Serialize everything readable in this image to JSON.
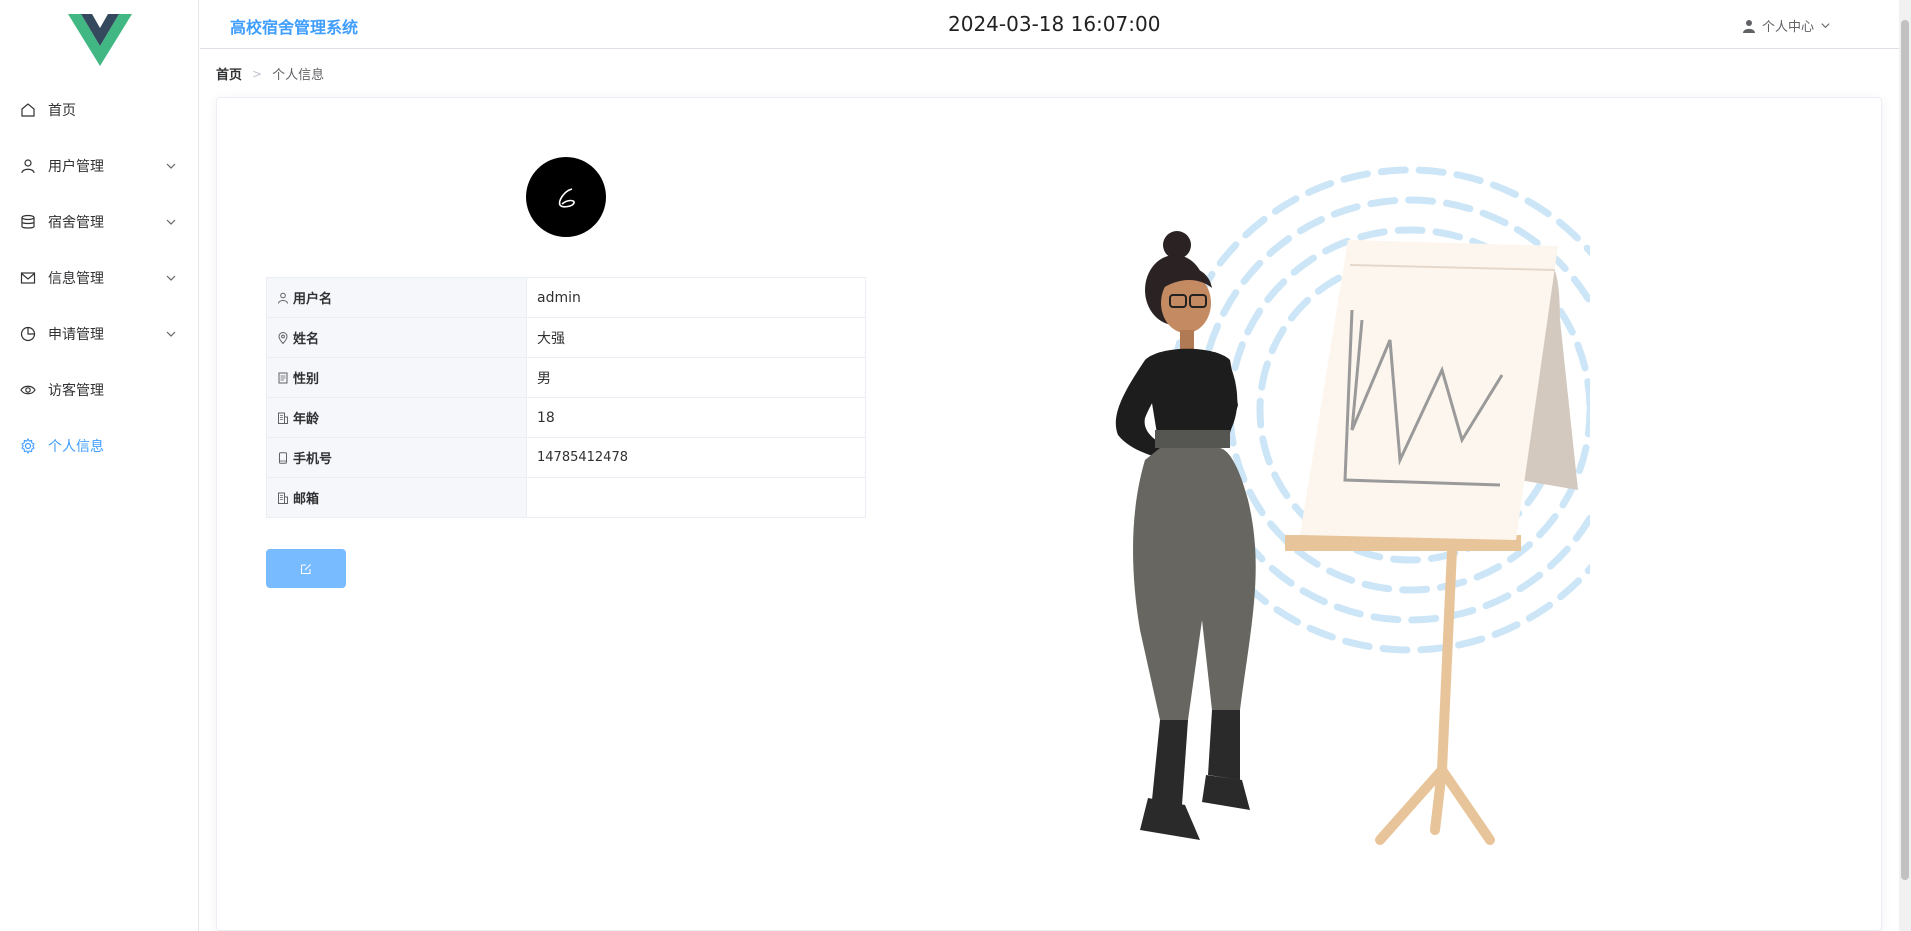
{
  "sidebar": {
    "logo_icon": "vue-logo-icon",
    "items": [
      {
        "label": "首页",
        "icon": "home-icon",
        "has_children": false
      },
      {
        "label": "用户管理",
        "icon": "user-icon",
        "has_children": true
      },
      {
        "label": "宿舍管理",
        "icon": "database-icon",
        "has_children": true
      },
      {
        "label": "信息管理",
        "icon": "mail-icon",
        "has_children": true
      },
      {
        "label": "申请管理",
        "icon": "pie-chart-icon",
        "has_children": true
      },
      {
        "label": "访客管理",
        "icon": "eye-icon",
        "has_children": false
      },
      {
        "label": "个人信息",
        "icon": "gear-icon",
        "has_children": false,
        "active": true
      }
    ]
  },
  "header": {
    "title": "高校宿舍管理系统",
    "datetime": "2024-03-18 16:07:00",
    "user_menu_label": "个人中心"
  },
  "breadcrumb": {
    "home": "首页",
    "separator": ">",
    "current": "个人信息"
  },
  "profile": {
    "fields": [
      {
        "label": "用户名",
        "value": "admin",
        "icon": "user-icon"
      },
      {
        "label": "姓名",
        "value": "大强",
        "icon": "location-icon"
      },
      {
        "label": "性别",
        "value": "男",
        "icon": "document-icon"
      },
      {
        "label": "年龄",
        "value": "18",
        "icon": "office-icon"
      },
      {
        "label": "手机号",
        "value": "14785412478",
        "icon": "phone-icon"
      },
      {
        "label": "邮箱",
        "value": "",
        "icon": "office-icon"
      }
    ],
    "edit_icon": "edit-icon"
  },
  "colors": {
    "accent": "#409eff",
    "button_disabled": "#79bbff"
  }
}
